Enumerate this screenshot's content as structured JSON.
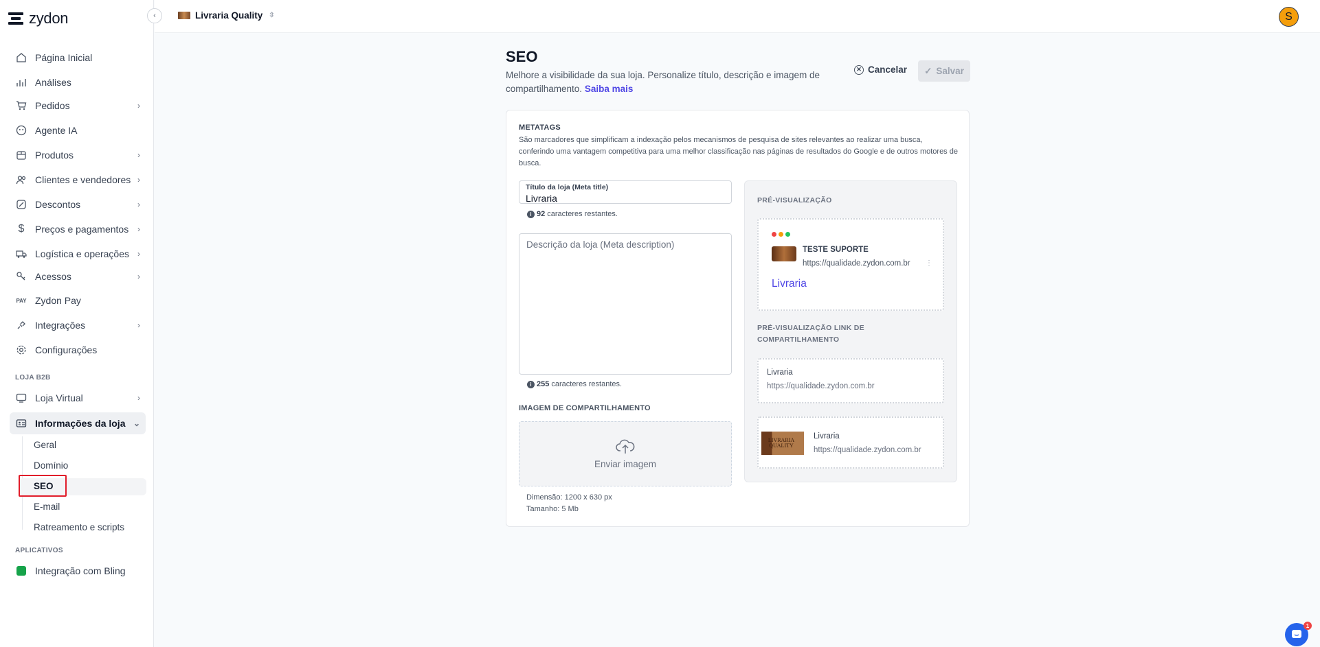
{
  "brand": {
    "name": "zydon"
  },
  "topbar": {
    "store_name": "Livraria Quality",
    "user_initial": "S"
  },
  "sidebar": {
    "items": [
      {
        "label": "Página Inicial",
        "has_children": false
      },
      {
        "label": "Análises",
        "has_children": false
      },
      {
        "label": "Pedidos",
        "has_children": true
      },
      {
        "label": "Agente IA",
        "has_children": false
      },
      {
        "label": "Produtos",
        "has_children": true
      },
      {
        "label": "Clientes e vendedores",
        "has_children": true
      },
      {
        "label": "Descontos",
        "has_children": true
      },
      {
        "label": "Preços e pagamentos",
        "has_children": true
      },
      {
        "label": "Logística e operações",
        "has_children": true
      },
      {
        "label": "Acessos",
        "has_children": true
      },
      {
        "label": "Zydon Pay",
        "has_children": false
      },
      {
        "label": "Integrações",
        "has_children": true
      },
      {
        "label": "Configurações",
        "has_children": false
      }
    ],
    "section_b2b": "LOJA B2B",
    "b2b_items": [
      {
        "label": "Loja Virtual"
      },
      {
        "label": "Informações da loja"
      }
    ],
    "sub_items": [
      "Geral",
      "Domínio",
      "SEO",
      "E-mail",
      "Ratreamento e scripts"
    ],
    "section_apps": "APLICATIVOS",
    "apps": [
      {
        "label": "Integração com Bling"
      }
    ]
  },
  "page": {
    "title": "SEO",
    "description": "Melhore a visibilidade da sua loja. Personalize título, descrição e imagem de compartilhamento.",
    "learn_more": "Saiba mais",
    "cancel_label": "Cancelar",
    "save_label": "Salvar"
  },
  "metatags": {
    "heading": "METATAGS",
    "description": "São marcadores que simplificam a indexação pelos mecanismos de pesquisa de sites relevantes ao realizar uma busca, conferindo uma vantagem competitiva para uma melhor classificação nas páginas de resultados do Google e de outros motores de busca.",
    "title_label": "Título da loja (Meta title)",
    "title_value": "Livraria",
    "title_remaining": "92",
    "remaining_suffix": "caracteres restantes.",
    "desc_placeholder": "Descrição da loja (Meta description)",
    "desc_remaining": "255",
    "image_heading": "IMAGEM DE COMPARTILHAMENTO",
    "upload_label": "Enviar imagem",
    "dimension": "Dimensão: 1200 x 630 px",
    "size": "Tamanho: 5 Mb"
  },
  "preview": {
    "heading": "PRÉ-VISUALIZAÇÃO",
    "site_name": "TESTE SUPORTE",
    "url": "https://qualidade.zydon.com.br",
    "result_title": "Livraria",
    "link_heading": "PRÉ-VISUALIZAÇÃO LINK DE COMPARTILHAMENTO",
    "link_title": "Livraria",
    "link_url": "https://qualidade.zydon.com.br",
    "thumb_text": "LIVRARIA QUALITY"
  },
  "chat": {
    "badge_count": "1"
  },
  "colors": {
    "accent": "#4f46e5",
    "highlight_box": "#e11d2a",
    "avatar": "#f59e0b"
  }
}
